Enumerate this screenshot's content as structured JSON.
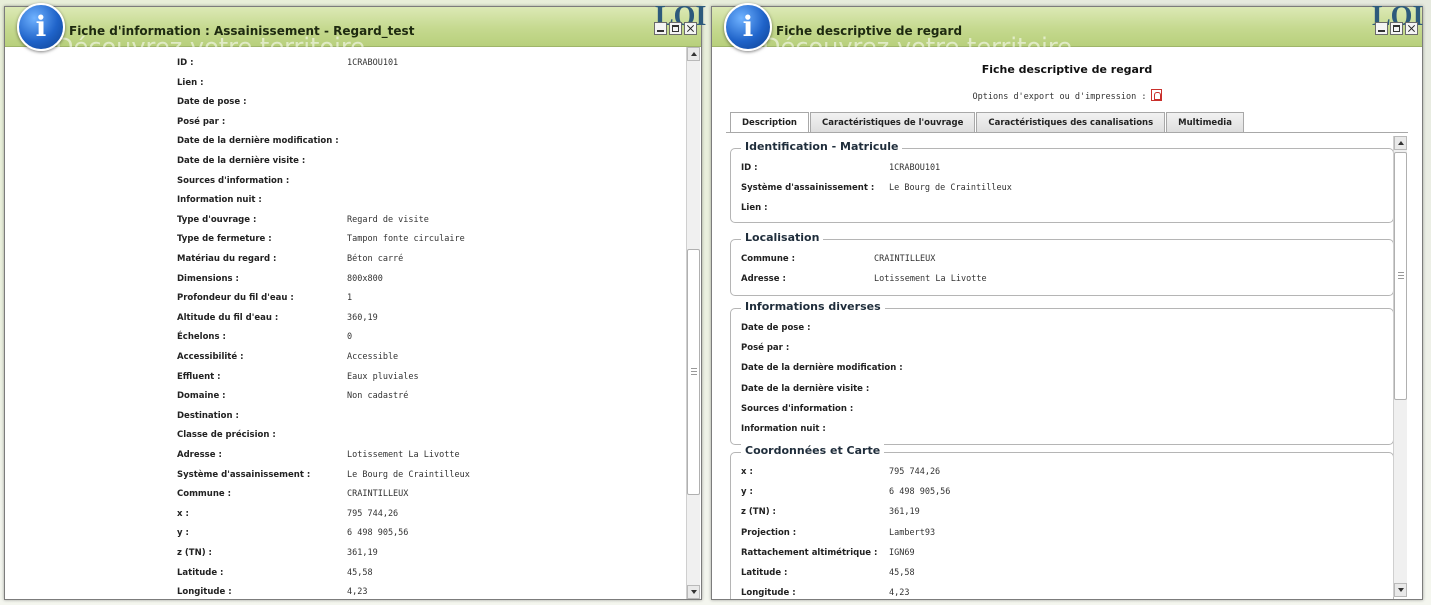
{
  "left_window": {
    "title": "Fiche d'information : Assainissement - Regard_test",
    "ghost_title": "Découvrez votre territoire",
    "rows": [
      {
        "label": "ID :",
        "value": "1CRABOU101"
      },
      {
        "label": "Lien :",
        "value": ""
      },
      {
        "label": "Date de pose :",
        "value": ""
      },
      {
        "label": "Posé par :",
        "value": ""
      },
      {
        "label": "Date de la dernière modification :",
        "value": ""
      },
      {
        "label": "Date de la dernière visite :",
        "value": ""
      },
      {
        "label": "Sources d'information :",
        "value": ""
      },
      {
        "label": "Information nuit :",
        "value": ""
      },
      {
        "label": "Type d'ouvrage :",
        "value": "Regard de visite"
      },
      {
        "label": "Type de fermeture :",
        "value": "Tampon fonte circulaire"
      },
      {
        "label": "Matériau du regard :",
        "value": "Béton carré"
      },
      {
        "label": "Dimensions :",
        "value": "800x800"
      },
      {
        "label": "Profondeur du fil d'eau :",
        "value": "1"
      },
      {
        "label": "Altitude du fil d'eau :",
        "value": "360,19"
      },
      {
        "label": "Échelons :",
        "value": "0"
      },
      {
        "label": "Accessibilité :",
        "value": "Accessible"
      },
      {
        "label": "Effluent :",
        "value": "Eaux pluviales"
      },
      {
        "label": "Domaine :",
        "value": "Non cadastré"
      },
      {
        "label": "Destination :",
        "value": ""
      },
      {
        "label": "Classe de précision :",
        "value": ""
      },
      {
        "label": "Adresse :",
        "value": "Lotissement La Livotte"
      },
      {
        "label": "Système d'assainissement :",
        "value": "Le Bourg de Craintilleux"
      },
      {
        "label": "Commune :",
        "value": "CRAINTILLEUX"
      },
      {
        "label": "x :",
        "value": "795 744,26"
      },
      {
        "label": "y :",
        "value": "6 498 905,56"
      },
      {
        "label": "z (TN) :",
        "value": "361,19"
      },
      {
        "label": "Latitude :",
        "value": "45,58"
      },
      {
        "label": "Longitude :",
        "value": "4,23"
      }
    ]
  },
  "right_window": {
    "title": "Fiche descriptive de regard",
    "ghost_title": "Découvrez votre territoire",
    "heading": "Fiche descriptive de regard",
    "export_label": "Options d'export ou d'impression :",
    "tabs": [
      "Description",
      "Caractéristiques de l'ouvrage",
      "Caractéristiques des canalisations",
      "Multimedia"
    ],
    "sections": [
      {
        "legend": "Identification - Matricule",
        "rows": [
          {
            "label": "ID :",
            "value": "1CRABOU101"
          },
          {
            "label": "Système d'assainissement :",
            "value": "Le Bourg de Craintilleux"
          },
          {
            "label": "Lien :",
            "value": ""
          }
        ]
      },
      {
        "legend": "Localisation",
        "rows": [
          {
            "label": "Commune :",
            "value": "CRAINTILLEUX"
          },
          {
            "label": "Adresse :",
            "value": "Lotissement La Livotte"
          }
        ]
      },
      {
        "legend": "Informations diverses",
        "rows": [
          {
            "label": "Date de pose :",
            "value": ""
          },
          {
            "label": "Posé par :",
            "value": ""
          },
          {
            "label": "Date de la dernière modification :",
            "value": ""
          },
          {
            "label": "Date de la dernière visite :",
            "value": ""
          },
          {
            "label": "Sources d'information :",
            "value": ""
          },
          {
            "label": "Information nuit :",
            "value": ""
          }
        ]
      },
      {
        "legend": "Coordonnées et Carte",
        "rows": [
          {
            "label": "x :",
            "value": "795 744,26"
          },
          {
            "label": "y :",
            "value": "6 498 905,56"
          },
          {
            "label": "z (TN) :",
            "value": "361,19"
          },
          {
            "label": "Projection :",
            "value": "Lambert93"
          },
          {
            "label": "Rattachement altimétrique :",
            "value": "IGN69"
          },
          {
            "label": "Latitude :",
            "value": "45,58"
          },
          {
            "label": "Longitude :",
            "value": "4,23"
          }
        ]
      }
    ]
  },
  "brand_ghost": "LOI",
  "colors": {
    "title_bar": "#c5d98f",
    "info_badge": "#1f63c9",
    "pdf_red": "#c9302c"
  }
}
